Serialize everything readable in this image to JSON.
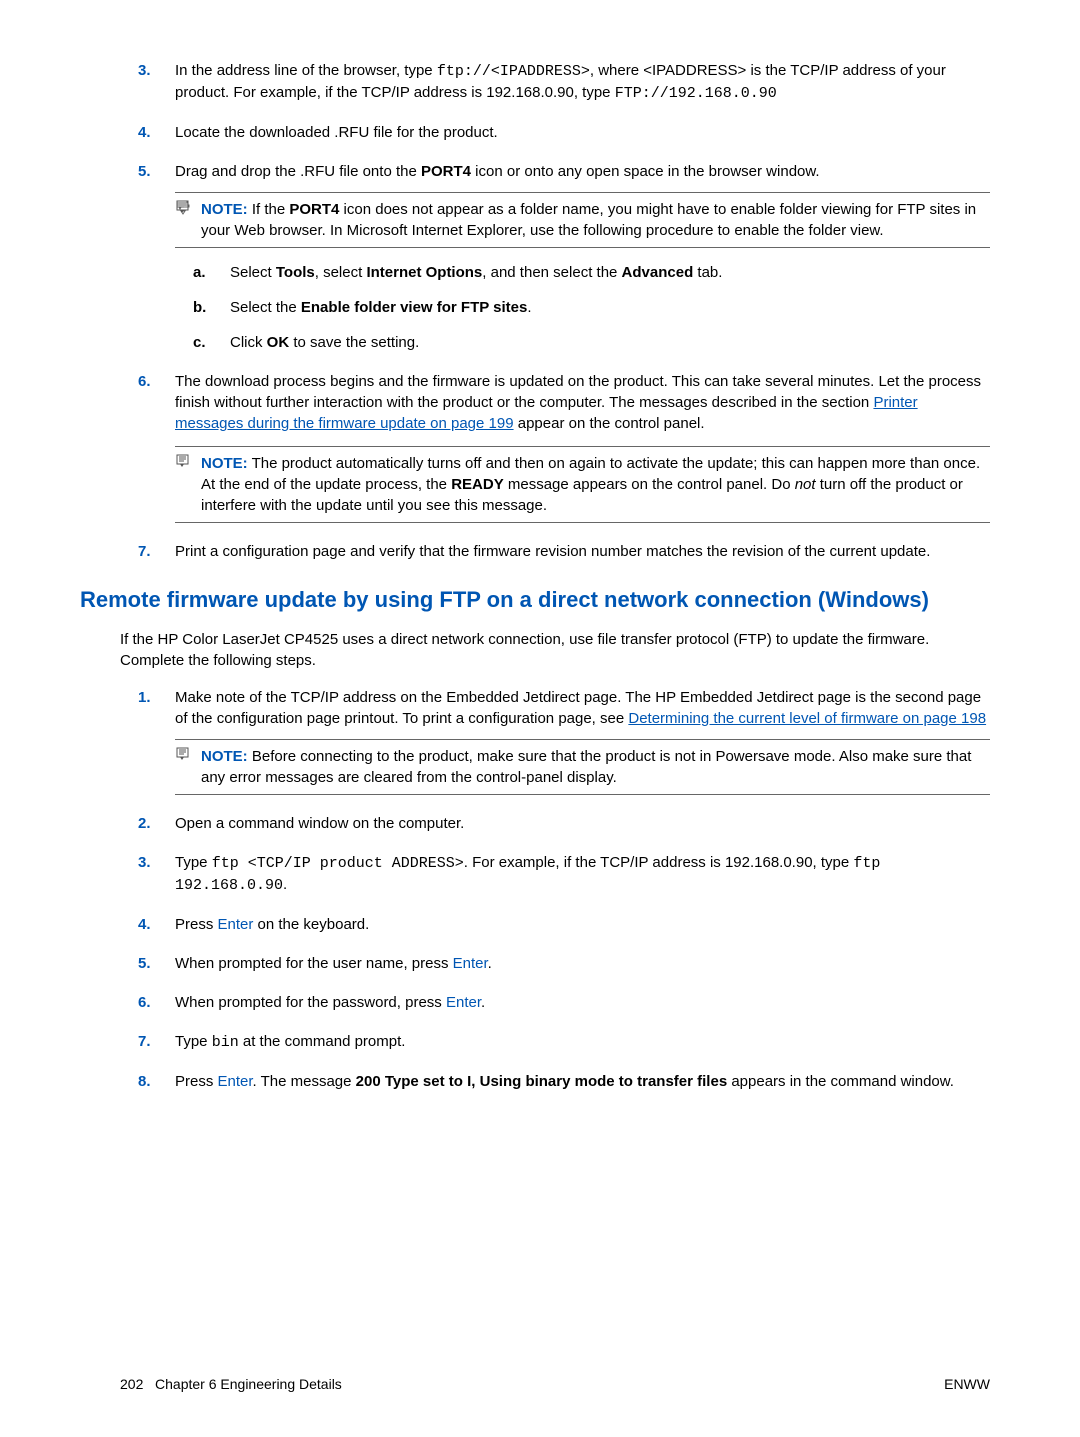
{
  "step3": {
    "num": "3.",
    "t1": "In the address line of the browser, type ",
    "c1": "ftp://<IPADDRESS>",
    "t2": ", where <IPADDRESS> is the TCP/IP address of your product. For example, if the TCP/IP address is 192.168.0.90, type ",
    "c2": "FTP://192.168.0.90"
  },
  "step4": {
    "num": "4.",
    "t": "Locate the downloaded .RFU file for the product."
  },
  "step5": {
    "num": "5.",
    "t1": "Drag and drop the .RFU file onto the ",
    "b1": "PORT4",
    "t2": " icon or onto any open space in the browser window."
  },
  "note1": {
    "label": "NOTE:",
    "t1": "If the ",
    "b1": "PORT4",
    "t2": " icon does not appear as a folder name, you might have to enable folder viewing for FTP sites in your Web browser. In Microsoft Internet Explorer, use the following procedure to enable the folder view."
  },
  "subA": {
    "l": "a.",
    "t1": "Select ",
    "b1": "Tools",
    "t2": ", select ",
    "b2": "Internet Options",
    "t3": ", and then select the ",
    "b3": "Advanced",
    "t4": " tab."
  },
  "subB": {
    "l": "b.",
    "t1": "Select the ",
    "b1": "Enable folder view for FTP sites",
    "t2": "."
  },
  "subC": {
    "l": "c.",
    "t1": "Click ",
    "b1": "OK",
    "t2": " to save the setting."
  },
  "step6": {
    "num": "6.",
    "t1": "The download process begins and the firmware is updated on the product. This can take several minutes. Let the process finish without further interaction with the product or the computer. The messages described in the section ",
    "link": "Printer messages during the firmware update  on page 199",
    "t2": " appear on the control panel."
  },
  "note2": {
    "label": "NOTE:",
    "t1": "The product automatically turns off and then on again to activate the update; this can happen more than once. At the end of the update process, the ",
    "b1": "READY",
    "t2": " message appears on the control panel. Do ",
    "i1": "not",
    "t3": " turn off the product or interfere with the update until you see this message."
  },
  "step7": {
    "num": "7.",
    "t": "Print a configuration page and verify that the firmware revision number matches the revision of the current update."
  },
  "heading": "Remote firmware update by using FTP on a direct network connection (Windows)",
  "intro": "If the HP Color LaserJet CP4525 uses a direct network connection, use file transfer protocol (FTP) to update the firmware. Complete the following steps.",
  "b1": {
    "num": "1.",
    "t1": "Make note of the TCP/IP address on the Embedded Jetdirect page. The HP Embedded Jetdirect page is the second page of the configuration page printout. To print a configuration page, see ",
    "link": "Determining the current level of firmware  on page 198"
  },
  "note3": {
    "label": "NOTE:",
    "t": "Before connecting to the product, make sure that the product is not in Powersave mode. Also make sure that any error messages are cleared from the control-panel display."
  },
  "b2": {
    "num": "2.",
    "t": "Open a command window on the computer."
  },
  "b3": {
    "num": "3.",
    "t1": "Type ",
    "c1": "ftp <TCP/IP product ADDRESS>",
    "t2": ". For example, if the TCP/IP address is 192.168.0.90, type ",
    "c2": "ftp 192.168.0.90",
    "t3": "."
  },
  "b4": {
    "num": "4.",
    "t1": "Press ",
    "k": "Enter",
    "t2": " on the keyboard."
  },
  "b5": {
    "num": "5.",
    "t1": "When prompted for the user name, press ",
    "k": "Enter",
    "t2": "."
  },
  "b6": {
    "num": "6.",
    "t1": "When prompted for the password, press ",
    "k": "Enter",
    "t2": "."
  },
  "b7": {
    "num": "7.",
    "t1": "Type ",
    "c": "bin",
    "t2": " at the command prompt."
  },
  "b8": {
    "num": "8.",
    "t1": "Press ",
    "k": "Enter",
    "t2": ". The message ",
    "b": "200 Type set to I, Using binary mode to transfer files",
    "t3": " appears in the command window."
  },
  "footer": {
    "left1": "202",
    "left2": "Chapter 6   Engineering Details",
    "right": "ENWW"
  }
}
